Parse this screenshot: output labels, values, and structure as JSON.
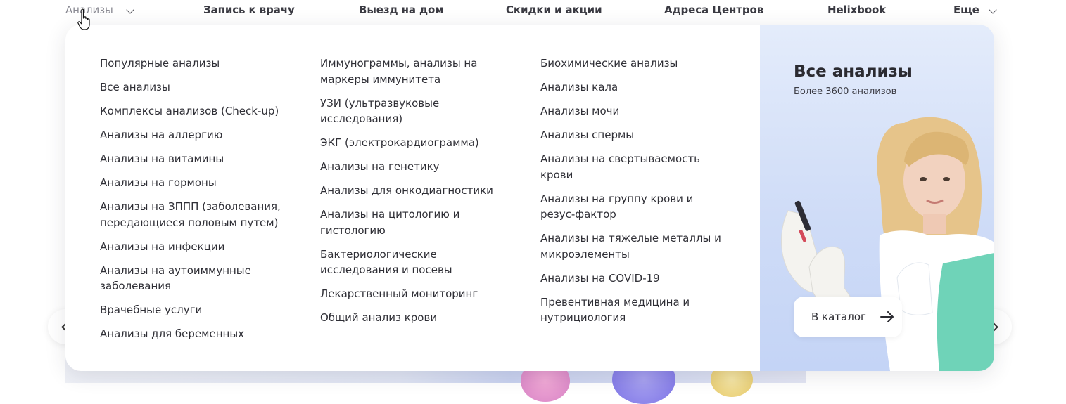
{
  "nav": {
    "items": [
      {
        "label": "Анализы"
      },
      {
        "label": "Запись к врачу"
      },
      {
        "label": "Выезд на дом"
      },
      {
        "label": "Скидки и акции"
      },
      {
        "label": "Адреса Центров"
      },
      {
        "label": "Helixbook"
      },
      {
        "label": "Еще"
      }
    ]
  },
  "menu": {
    "col1": [
      "Популярные анализы",
      "Все анализы",
      "Комплексы анализов (Check-up)",
      "Анализы на аллергию",
      "Анализы на витамины",
      "Анализы на гормоны",
      "Анализы на ЗППП (заболевания, передающиеся половым путем)",
      "Анализы на инфекции",
      "Анализы на аутоиммунные заболевания",
      "Врачебные услуги",
      "Анализы для беременных"
    ],
    "col2": [
      "Иммунограммы, анализы на маркеры иммунитета",
      "УЗИ (ультразвуковые исследования)",
      "ЭКГ (электрокардиограмма)",
      "Анализы на генетику",
      "Анализы для онкодиагностики",
      "Анализы на цитологию и гистологию",
      "Бактериологические исследования и посевы",
      "Лекарственный мониторинг",
      "Общий анализ крови"
    ],
    "col3": [
      "Биохимические анализы",
      "Анализы кала",
      "Анализы мочи",
      "Анализы спермы",
      "Анализы на свертываемость крови",
      "Анализы на группу крови и резус-фактор",
      "Анализы на тяжелые металлы и микроэлементы",
      "Анализы на COVID-19",
      "Превентивная медицина и нутрициология"
    ]
  },
  "promo": {
    "title": "Все анализы",
    "subtitle": "Более 3600 анализов",
    "button_label": "В каталог"
  },
  "icons": {
    "nav_chevron": "chevron-down-icon",
    "cursor": "hand-pointer-icon",
    "button_arrow": "arrow-right-icon",
    "carousel_prev": "chevron-left-icon",
    "carousel_next": "chevron-right-icon"
  },
  "colors": {
    "text": "#2f2f36",
    "promo_bg": "#cfdcf7",
    "nav_active": "#8a8a93"
  }
}
